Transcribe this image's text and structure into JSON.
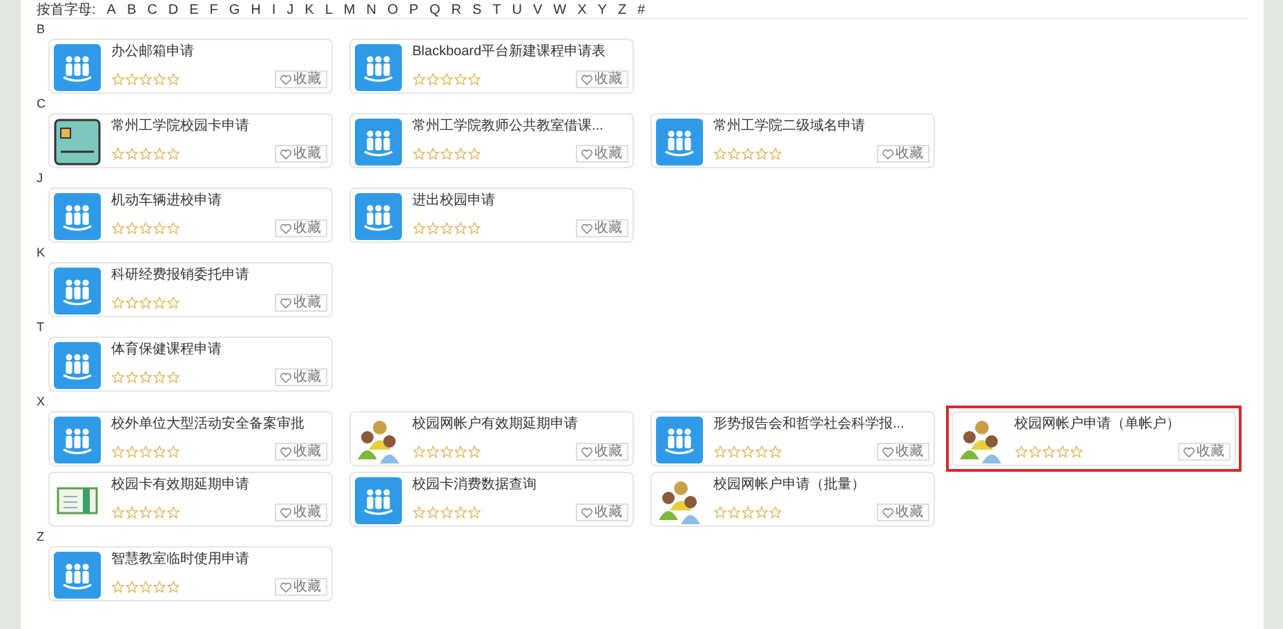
{
  "letter_index": {
    "label": "按首字母:",
    "letters": [
      "A",
      "B",
      "C",
      "D",
      "E",
      "F",
      "G",
      "H",
      "I",
      "J",
      "K",
      "L",
      "M",
      "N",
      "O",
      "P",
      "Q",
      "R",
      "S",
      "T",
      "U",
      "V",
      "W",
      "X",
      "Y",
      "Z",
      "#"
    ]
  },
  "groups": [
    {
      "letter": "B",
      "items": [
        {
          "title": "办公邮箱申请",
          "kind": "people",
          "stars": 0,
          "favorite": "收藏",
          "selected": false
        },
        {
          "title": "Blackboard平台新建课程申请表",
          "kind": "people",
          "stars": 0,
          "favorite": "收藏",
          "selected": false
        }
      ]
    },
    {
      "letter": "C",
      "items": [
        {
          "title": "常州工学院校园卡申请",
          "kind": "card",
          "stars": 0,
          "favorite": "收藏",
          "selected": false
        },
        {
          "title": "常州工学院教师公共教室借课...",
          "kind": "people",
          "stars": 0,
          "favorite": "收藏",
          "selected": false
        },
        {
          "title": "常州工学院二级域名申请",
          "kind": "people",
          "stars": 0,
          "favorite": "收藏",
          "selected": false
        }
      ]
    },
    {
      "letter": "J",
      "items": [
        {
          "title": "机动车辆进校申请",
          "kind": "people",
          "stars": 0,
          "favorite": "收藏",
          "selected": false
        },
        {
          "title": "进出校园申请",
          "kind": "people",
          "stars": 0,
          "favorite": "收藏",
          "selected": false
        }
      ]
    },
    {
      "letter": "K",
      "items": [
        {
          "title": "科研经费报销委托申请",
          "kind": "people",
          "stars": 0,
          "favorite": "收藏",
          "selected": false
        }
      ]
    },
    {
      "letter": "T",
      "items": [
        {
          "title": "体育保健课程申请",
          "kind": "people",
          "stars": 0,
          "favorite": "收藏",
          "selected": false
        }
      ]
    },
    {
      "letter": "X",
      "items": [
        {
          "title": "校外单位大型活动安全备案审批",
          "kind": "people",
          "stars": 0,
          "favorite": "收藏",
          "selected": false
        },
        {
          "title": "校园网帐户有效期延期申请",
          "kind": "users",
          "stars": 0,
          "favorite": "收藏",
          "selected": false
        },
        {
          "title": "形势报告会和哲学社会科学报...",
          "kind": "people",
          "stars": 0,
          "favorite": "收藏",
          "selected": false
        },
        {
          "title": "校园网帐户申请（单帐户）",
          "kind": "users",
          "stars": 0,
          "favorite": "收藏",
          "selected": true
        },
        {
          "title": "校园卡有效期延期申请",
          "kind": "book",
          "stars": 0,
          "favorite": "收藏",
          "selected": false
        },
        {
          "title": "校园卡消费数据查询",
          "kind": "people",
          "stars": 0,
          "favorite": "收藏",
          "selected": false
        },
        {
          "title": "校园网帐户申请（批量）",
          "kind": "users",
          "stars": 0,
          "favorite": "收藏",
          "selected": false
        }
      ]
    },
    {
      "letter": "Z",
      "items": [
        {
          "title": "智慧教室临时使用申请",
          "kind": "people",
          "stars": 0,
          "favorite": "收藏",
          "selected": false
        }
      ]
    }
  ]
}
